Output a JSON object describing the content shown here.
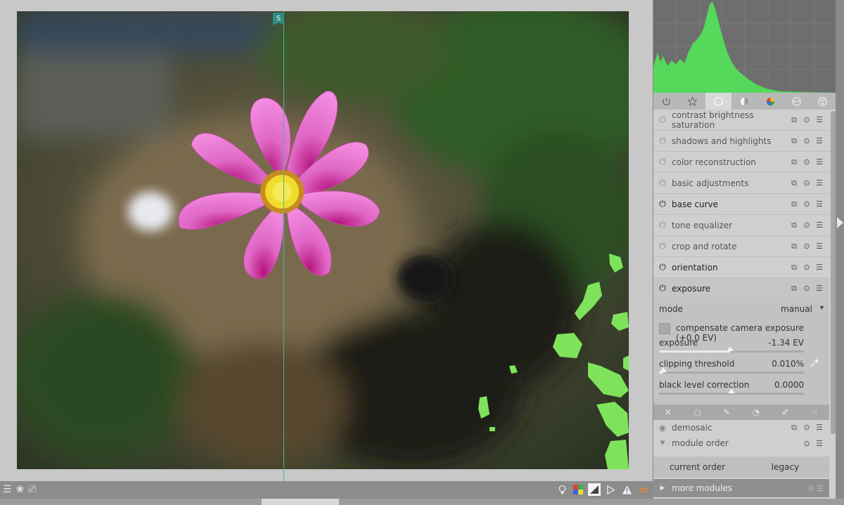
{
  "guide": {
    "marker_label": "S"
  },
  "tabs": [
    {
      "icon": "power-icon"
    },
    {
      "icon": "star-icon"
    },
    {
      "icon": "circle-icon",
      "active": true
    },
    {
      "icon": "half-circle-icon"
    },
    {
      "icon": "color-ball-icon"
    },
    {
      "icon": "correct-icon"
    },
    {
      "icon": "effect-icon"
    }
  ],
  "modules": [
    {
      "label": "contrast brightness saturation",
      "on": false
    },
    {
      "label": "shadows and highlights",
      "on": false
    },
    {
      "label": "color reconstruction",
      "on": false
    },
    {
      "label": "basic adjustments",
      "on": false
    },
    {
      "label": "base curve",
      "on": true
    },
    {
      "label": "tone equalizer",
      "on": false
    },
    {
      "label": "crop and rotate",
      "on": false
    },
    {
      "label": "orientation",
      "on": true
    },
    {
      "label": "exposure",
      "on": true,
      "expanded": true
    }
  ],
  "exposure": {
    "mode_label": "mode",
    "mode_value": "manual",
    "mode_arrow": "▾",
    "compensate_label": "compensate camera exposure (+0.0 EV)",
    "exposure_label": "exposure",
    "exposure_value": "-1.34 EV",
    "exposure_fill": 0.49,
    "clipping_label": "clipping threshold",
    "clipping_value": "0.010%",
    "clipping_fill": 0.03,
    "black_label": "black level correction",
    "black_value": "0.0000",
    "black_fill": 0.5
  },
  "lower": {
    "demosaic": "demosaic",
    "module_order": "module order",
    "current_order_label": "current order",
    "current_order_value": "legacy",
    "more_modules": "more modules"
  },
  "colors": {
    "histogram_fill": "#55d95a",
    "overexposure": "#7ee35a",
    "guide": "#3fb7a8"
  }
}
